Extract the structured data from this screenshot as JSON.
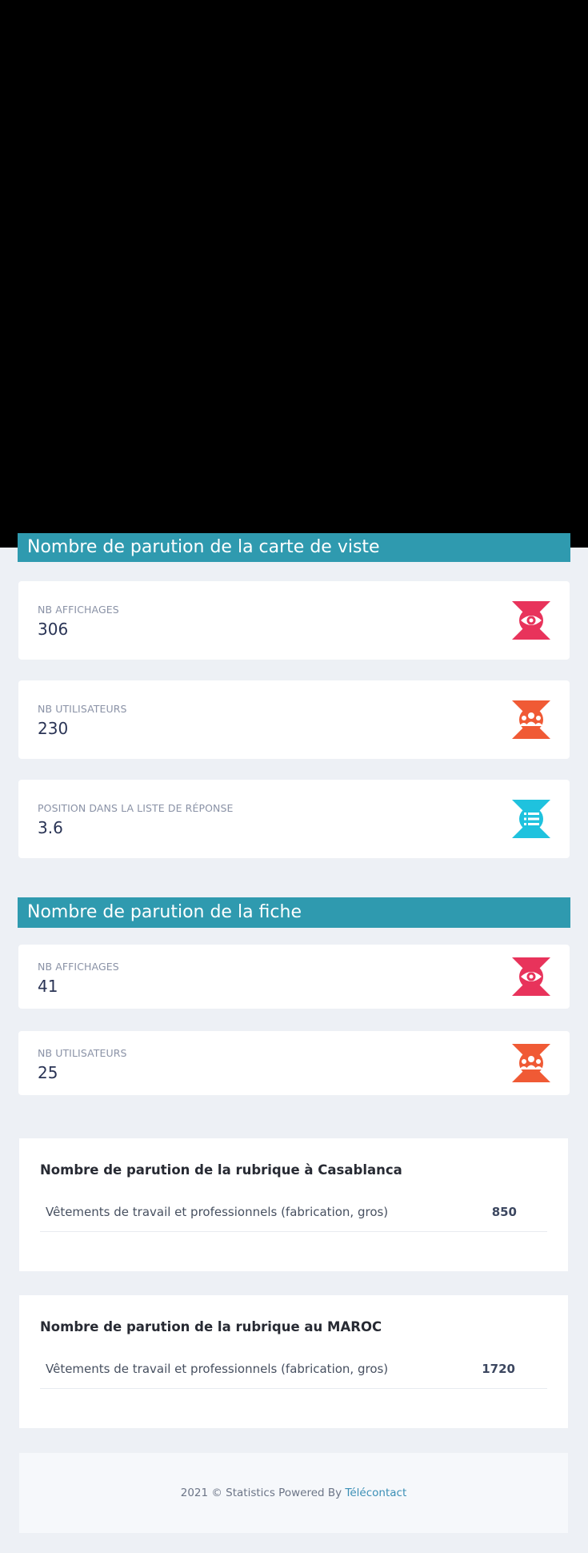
{
  "colors": {
    "section_header_bg": "#2f9aaf",
    "icon_eye": "#e8335b",
    "icon_users": "#f05a35",
    "icon_list": "#1fc2de",
    "page_bg": "#edf0f5"
  },
  "carte_visite": {
    "header": "Nombre de parution de la carte de viste",
    "stats": [
      {
        "label": "NB AFFICHAGES",
        "value": "306",
        "icon": "eye-icon"
      },
      {
        "label": "NB UTILISATEURS",
        "value": "230",
        "icon": "users-icon"
      },
      {
        "label": "POSITION DANS LA LISTE DE RÉPONSE",
        "value": "3.6",
        "icon": "list-icon"
      }
    ]
  },
  "fiche": {
    "header": "Nombre de parution de la fiche",
    "stats": [
      {
        "label": "NB AFFICHAGES",
        "value": "41",
        "icon": "eye-icon"
      },
      {
        "label": "NB UTILISATEURS",
        "value": "25",
        "icon": "users-icon"
      }
    ]
  },
  "rubrique_casablanca": {
    "title": "Nombre de parution de la rubrique à Casablanca",
    "rows": [
      {
        "name": "Vêtements de travail et professionnels (fabrication, gros)",
        "count": "850"
      }
    ]
  },
  "rubrique_maroc": {
    "title": "Nombre de parution de la rubrique au MAROC",
    "rows": [
      {
        "name": "Vêtements de travail et professionnels (fabrication, gros)",
        "count": "1720"
      }
    ]
  },
  "footer": {
    "text": "2021 © Statistics Powered By",
    "link": "Télécontact"
  }
}
